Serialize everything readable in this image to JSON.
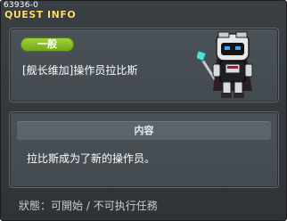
{
  "quest": {
    "id_text": "63936-0",
    "window_title": "QUEST INFO",
    "category_badge": "一般",
    "name": "[舰长维加]操作员拉比斯",
    "content_header": "内容",
    "content_text": "拉比斯成为了新的操作员。",
    "status_label": "狀態：",
    "status_value": "可開始 / 不可执行任務"
  },
  "colors": {
    "title": "#ffe066",
    "badge": "#8cc425",
    "panel": "#474e54",
    "window": "#353a3e"
  },
  "icons": {
    "title_icon": "quest-icon",
    "npc_portrait": "npc-robot-sprite"
  }
}
